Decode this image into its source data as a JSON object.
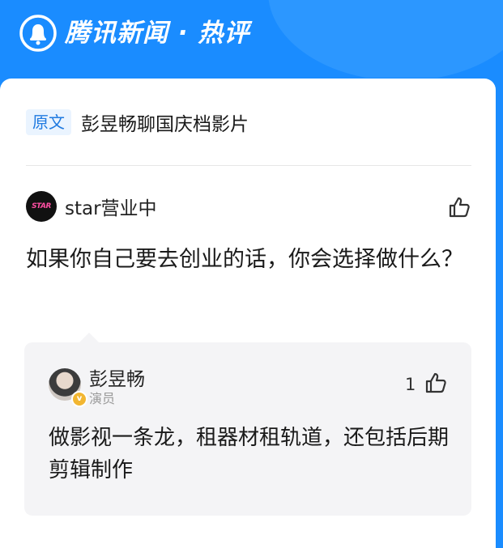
{
  "header": {
    "brand": "腾讯新闻 · 热评",
    "icon": "tencent-news-bell-icon"
  },
  "article": {
    "tag": "原文",
    "title": "彭昱畅聊国庆档影片"
  },
  "comment": {
    "avatar_text": "STAR",
    "user": "star营业中",
    "like_icon": "thumbs-up-icon",
    "text": "如果你自己要去创业的话，你会选择做什么？"
  },
  "reply": {
    "user": "彭昱畅",
    "role": "演员",
    "verified_icon": "verified-badge-icon",
    "like_count": "1",
    "like_icon": "thumbs-up-icon",
    "text": "做影视一条龙，租器材租轨道，还包括后期剪辑制作"
  },
  "colors": {
    "brand_blue": "#1a8cff",
    "tag_blue": "#1f7ae0",
    "reply_bg": "#f4f4f6"
  }
}
